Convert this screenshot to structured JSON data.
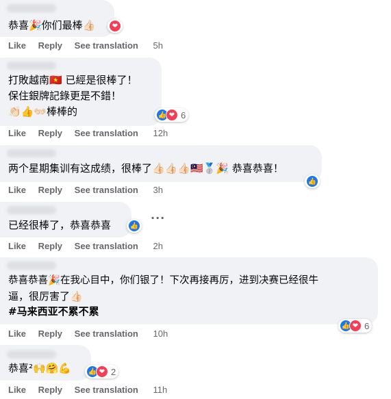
{
  "actions": {
    "like": "Like",
    "reply": "Reply",
    "see_translation": "See translation"
  },
  "comments": [
    {
      "lines": [
        "恭喜🎉你们最棒👍🏻"
      ],
      "reaction_icon": "love-icon",
      "time": "5h"
    },
    {
      "lines": [
        "打敗越南🇻🇳 已經是很棒了！",
        "保住銀牌記錄更是不錯！",
        "👏🏻👍👐🏻棒棒的"
      ],
      "reactions": [
        "like-icon",
        "love-icon"
      ],
      "reaction_count": "6",
      "time": "12h"
    },
    {
      "lines": [
        "两个星期集训有这成绩，很棒了👍🏻👍🏻👍🏻🇲🇾🥈🎉 恭喜恭喜！"
      ],
      "reactions": [
        "like-icon"
      ],
      "time": "3h"
    },
    {
      "lines": [
        "已经很棒了，恭喜恭喜"
      ],
      "reactions": [
        "like-icon"
      ],
      "time": "2h",
      "more": "···"
    },
    {
      "lines": [
        "恭喜恭喜🎉在我心目中，你们银了！下次再接再厉，进到决赛已经很牛",
        "逼，很厉害了👍🏻"
      ],
      "hashtag": "#马来西亚不累不累",
      "reactions": [
        "like-icon",
        "love-icon"
      ],
      "reaction_count": "6",
      "time": "10h"
    },
    {
      "lines": [
        "恭喜²🙌🤗💪"
      ],
      "reactions": [
        "like-icon",
        "love-icon"
      ],
      "reaction_count": "2",
      "time": "11h"
    }
  ],
  "colors": {
    "bubble": "#f0f2f5",
    "action_text": "#65676b",
    "like_blue": "#1877f2",
    "love_red": "#f33e58"
  }
}
